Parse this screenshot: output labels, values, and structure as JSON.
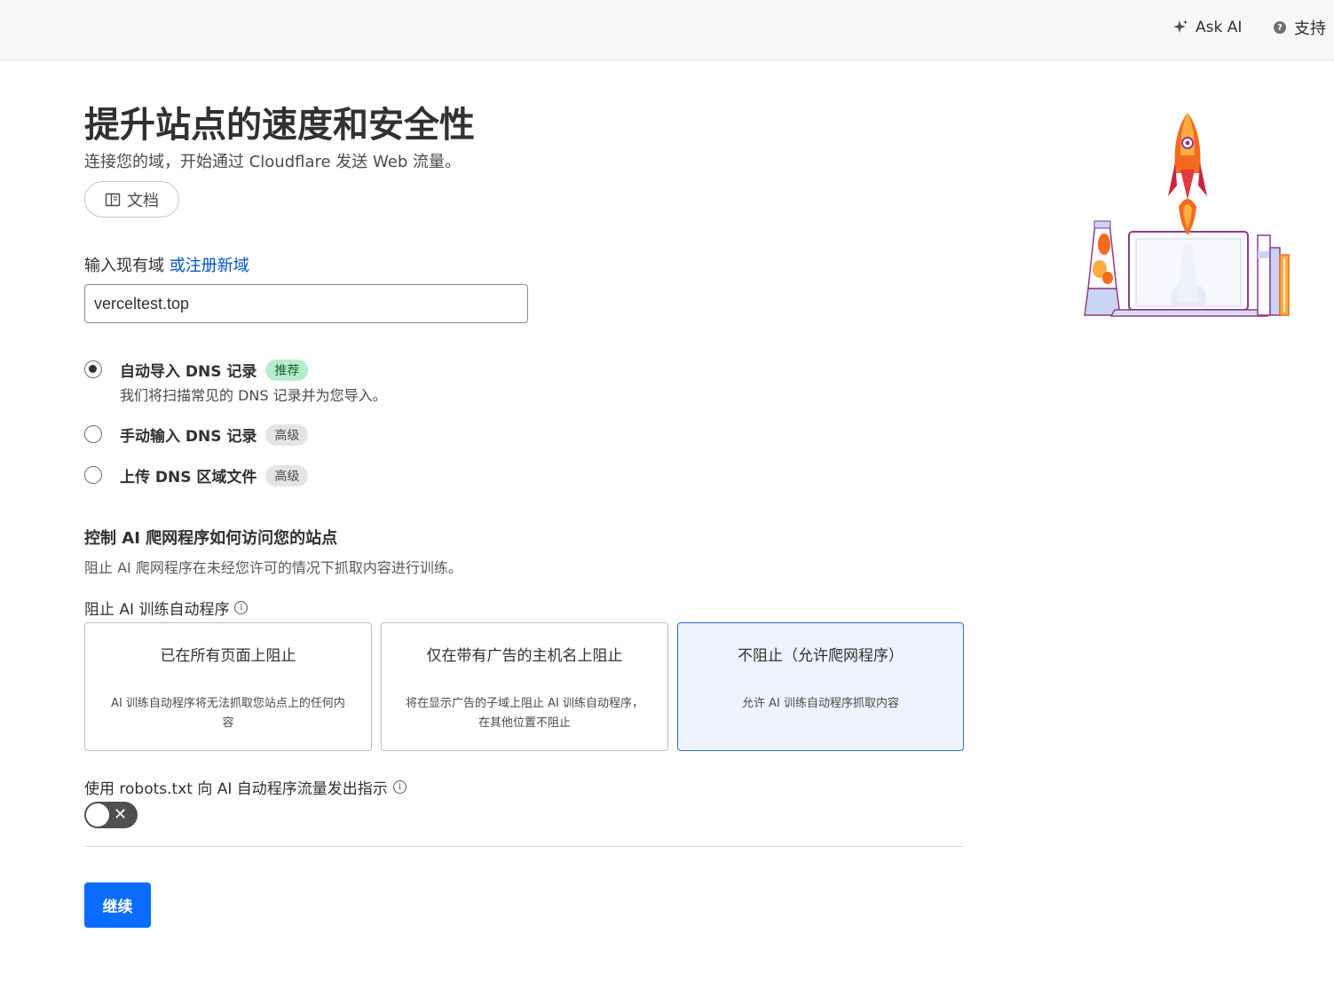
{
  "header": {
    "ask_ai_label": "Ask AI",
    "support_label": "支持"
  },
  "hero": {
    "title": "提升站点的速度和安全性",
    "subtitle": "连接您的域，开始通过 Cloudflare 发送 Web 流量。",
    "docs_label": "文档"
  },
  "domain": {
    "label": "输入现有域",
    "register_link": "或注册新域",
    "value": "verceltest.top"
  },
  "dns_options": [
    {
      "title": "自动导入 DNS 记录",
      "badge": "推荐",
      "description": "我们将扫描常见的 DNS 记录并为您导入。",
      "selected": true
    },
    {
      "title": "手动输入 DNS 记录",
      "badge": "高级",
      "selected": false
    },
    {
      "title": "上传 DNS 区域文件",
      "badge": "高级",
      "selected": false
    }
  ],
  "ai_crawlers": {
    "title": "控制 AI 爬网程序如何访问您的站点",
    "description": "阻止 AI 爬网程序在未经您许可的情况下抓取内容进行训练。",
    "block_label": "阻止 AI 训练自动程序",
    "cards": [
      {
        "title": "已在所有页面上阻止",
        "description": "AI 训练自动程序将无法抓取您站点上的任何内容",
        "selected": false
      },
      {
        "title": "仅在带有广告的主机名上阻止",
        "description": "将在显示广告的子域上阻止 AI 训练自动程序，在其他位置不阻止",
        "selected": false
      },
      {
        "title": "不阻止（允许爬网程序）",
        "description": "允许 AI 训练自动程序抓取内容",
        "selected": true
      }
    ],
    "robots_label": "使用 robots.txt 向 AI 自动程序流量发出指示",
    "robots_enabled": false
  },
  "footer": {
    "continue_label": "继续"
  },
  "colors": {
    "accent": "#0a6cff",
    "link": "#0051c3",
    "selected_card_bg": "#edf4ff",
    "recommended_badge_bg": "#b7ecc9"
  },
  "icons": [
    "sparkle-icon",
    "help-icon",
    "book-icon",
    "info-icon",
    "close-icon",
    "rocket-laptop-illustration"
  ]
}
